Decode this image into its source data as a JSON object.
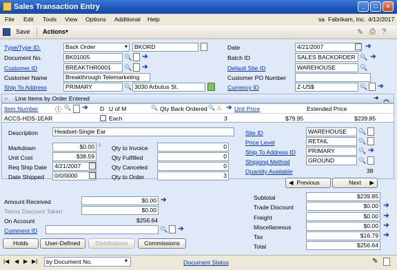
{
  "window": {
    "title": "Sales Transaction Entry",
    "minimize": "_",
    "maximize": "□",
    "close": "×"
  },
  "menu": [
    "File",
    "Edit",
    "Tools",
    "View",
    "Options",
    "Additional",
    "Help"
  ],
  "status_info": {
    "user": "sa",
    "company": "Fabrikam, Inc.",
    "date": "4/12/2017"
  },
  "toolbar": {
    "save": "Save",
    "actions": "Actions"
  },
  "header": {
    "type_label": "Type/Type ID:",
    "type_value": "Back Order",
    "type_id": "BKORD",
    "document_no_label": "Document No.",
    "document_no": "BK01005",
    "customer_id_label": "Customer ID",
    "customer_id": "BREAKTHR0001",
    "customer_name_label": "Customer Name",
    "customer_name": "Breakthrough Telemarketing",
    "ship_to_label": "Ship To Address",
    "ship_to_id": "PRIMARY",
    "ship_to_address": "3030 Arbutus St.",
    "date_label": "Date",
    "date": "4/21/2007",
    "batch_id_label": "Batch ID",
    "batch_id": "SALES BACKORDER",
    "site_id_label": "Default Site ID",
    "site_id": "WAREHOUSE",
    "po_label": "Customer PO Number",
    "po": "",
    "currency_label": "Currency ID",
    "currency": "Z-US$"
  },
  "lines": {
    "section_title": "Line Items by Order Entered",
    "columns": {
      "item": "Item Number",
      "d": "D",
      "uofm": "U of M",
      "qty": "Qty Back Ordered",
      "unit_price": "Unit Price",
      "extended": "Extended Price"
    },
    "row": {
      "item": "ACCS-HDS-1EAR",
      "uofm": "Each",
      "qty": "3",
      "unit_price": "$79.95",
      "extended": "$239.85"
    },
    "description_label": "Description",
    "description": "Headset-Single Ear",
    "markdown_label": "Markdown",
    "markdown": "$0.00",
    "unit_cost_label": "Unit Cost",
    "unit_cost": "$38.59",
    "req_ship_label": "Req Ship Date",
    "req_ship": "4/21/2007",
    "date_shipped_label": "Date Shipped",
    "date_shipped": "0/0/0000",
    "qty_invoice_label": "Qty to Invoice",
    "qty_invoice": "0",
    "qty_fulfilled_label": "Qty Fulfilled",
    "qty_fulfilled": "0",
    "qty_canceled_label": "Qty Canceled",
    "qty_canceled": "0",
    "qty_order_label": "Qty to Order",
    "qty_order": "3",
    "line_site_label": "Site ID",
    "line_site": "WAREHOUSE",
    "price_level_label": "Price Level",
    "price_level": "RETAIL",
    "ship_addr_label": "Ship To Address ID",
    "ship_addr": "PRIMARY",
    "ship_method_label": "Shipping Method",
    "ship_method": "GROUND",
    "qty_avail_label": "Quantity Available",
    "qty_avail": "38",
    "previous": "Previous",
    "next": "Next"
  },
  "payments": {
    "amount_received_label": "Amount Received",
    "amount_received": "$0.00",
    "terms_discount_label": "Terms Discount Taken",
    "terms_discount": "$0.00",
    "on_account_label": "On Account",
    "on_account": "$256.64",
    "comment_id_label": "Comment ID",
    "comment_id": ""
  },
  "totals": {
    "subtotal_label": "Subtotal",
    "subtotal": "$239.85",
    "trade_discount_label": "Trade Discount",
    "trade_discount": "$0.00",
    "freight_label": "Freight",
    "freight": "$0.00",
    "misc_label": "Miscellaneous",
    "misc": "$0.00",
    "tax_label": "Tax",
    "tax": "$16.79",
    "total_label": "Total",
    "total": "$256.64"
  },
  "buttons": {
    "holds": "Holds",
    "user_defined": "User-Defined",
    "distributions": "Distributions",
    "commissions": "Commissions"
  },
  "footer": {
    "sort": "by Document No.",
    "doc_status": "Document Status"
  }
}
